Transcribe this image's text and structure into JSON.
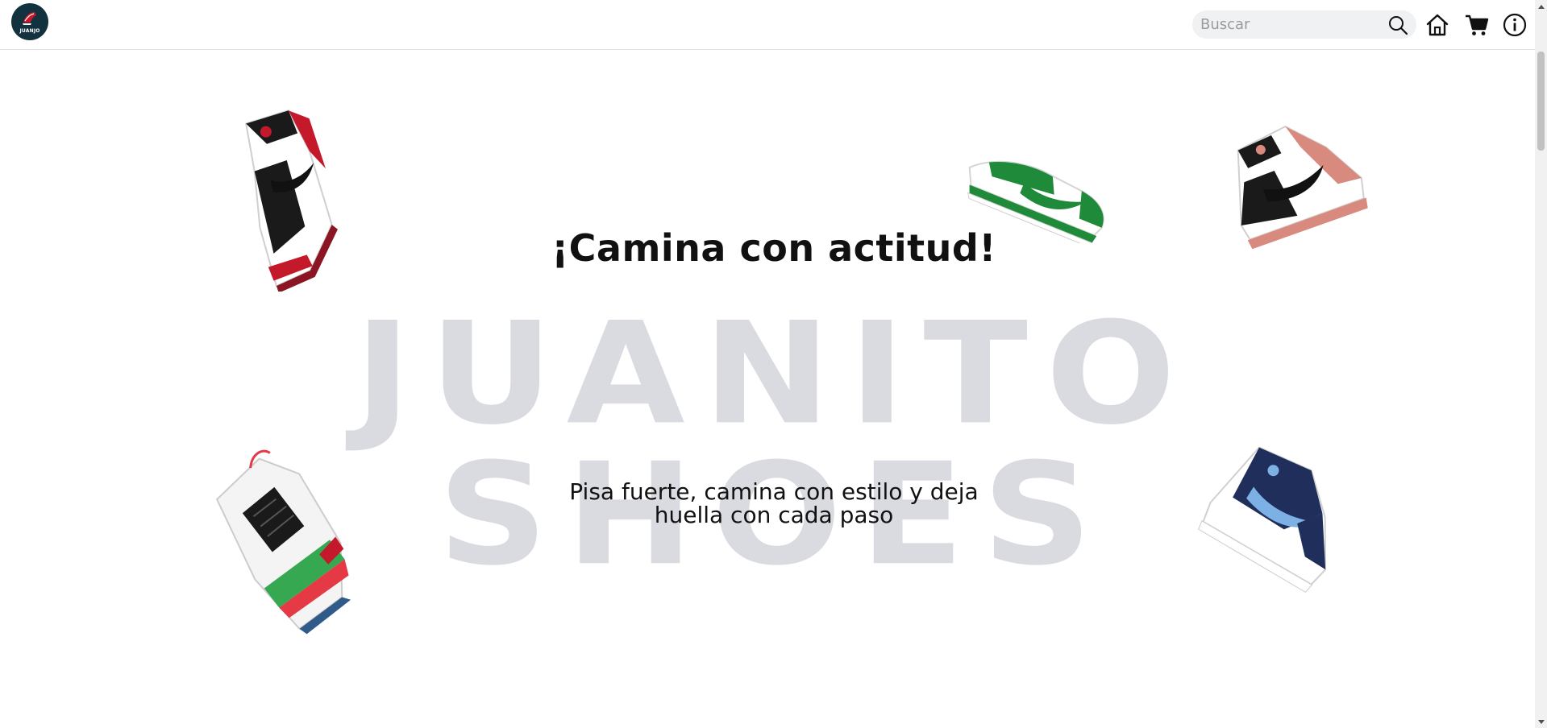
{
  "header": {
    "logo_text": "JUANJO",
    "search_placeholder": "Buscar",
    "search_value": "",
    "icons": [
      "search-icon",
      "home-icon",
      "cart-icon",
      "info-icon"
    ]
  },
  "hero": {
    "tagline": "¡Camina con actitud!",
    "brand": "JUANITO SHOES",
    "subtitle_line1": "Pisa fuerte, camina con estilo y deja",
    "subtitle_line2": "huella con cada paso"
  },
  "colors": {
    "logo_bg": "#12323f",
    "brand_text": "#dadbe0",
    "search_bg": "#f0f1f3",
    "shoe_red": "#c4182b",
    "shoe_green": "#1e8a3a",
    "shoe_pink": "#d98a7e",
    "shoe_navy": "#1f2e5a",
    "shoe_lightblue": "#7db1e6"
  }
}
